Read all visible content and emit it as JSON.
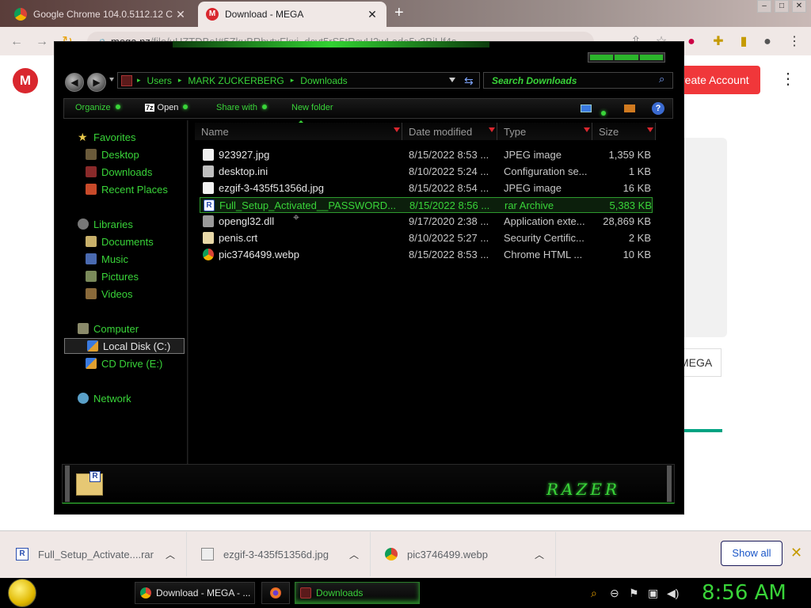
{
  "browser": {
    "tabs": [
      {
        "title": "Google Chrome 104.0.5112.12 C",
        "active": false
      },
      {
        "title": "Download - MEGA",
        "active": true
      }
    ],
    "new_tab_label": "+",
    "omnibox": {
      "domain": "mega.nz",
      "path": "/file/uHZTDBoI#5ZkuBRbvtxFkxi_dcvt5rS5tRcvH2wLado5y3BiLlf4s"
    }
  },
  "mega": {
    "logo_letter": "M",
    "create_account": "reate Account",
    "button_partial": "MEGA"
  },
  "explorer": {
    "breadcrumbs": [
      "Users",
      "MARK ZUCKERBERG",
      "Downloads"
    ],
    "search_placeholder": "Search Downloads",
    "commands": {
      "organize": "Organize",
      "open": "Open",
      "share_with": "Share with",
      "new_folder": "New folder",
      "open_badge": "7z"
    },
    "nav": {
      "favorites": "Favorites",
      "desktop": "Desktop",
      "downloads": "Downloads",
      "recent": "Recent Places",
      "libraries": "Libraries",
      "documents": "Documents",
      "music": "Music",
      "pictures": "Pictures",
      "videos": "Videos",
      "computer": "Computer",
      "local_disk": "Local Disk (C:)",
      "cd_drive": "CD Drive (E:)",
      "network": "Network"
    },
    "columns": [
      "Name",
      "Date modified",
      "Type",
      "Size"
    ],
    "files": [
      {
        "name": "923927.jpg",
        "date": "8/15/2022 8:53 ...",
        "type": "JPEG image",
        "size": "1,359 KB",
        "icon": "image-file-icon",
        "color": "#f2f2f2"
      },
      {
        "name": "desktop.ini",
        "date": "8/10/2022 5:24 ...",
        "type": "Configuration se...",
        "size": "1 KB",
        "icon": "config-file-icon",
        "color": "#bfbfbf"
      },
      {
        "name": "ezgif-3-435f51356d.jpg",
        "date": "8/15/2022 8:54 ...",
        "type": "JPEG image",
        "size": "16 KB",
        "icon": "image-file-icon",
        "color": "#f2f2f2"
      },
      {
        "name": "Full_Setup_Activated__PASSWORD...",
        "date": "8/15/2022 8:56 ...",
        "type": "rar Archive",
        "size": "5,383 KB",
        "icon": "rar-archive-icon",
        "color": "#2a4fb0"
      },
      {
        "name": "opengl32.dll",
        "date": "9/17/2020 2:38 ...",
        "type": "Application exte...",
        "size": "28,869 KB",
        "icon": "dll-file-icon",
        "color": "#9a9a9a"
      },
      {
        "name": "penis.crt",
        "date": "8/10/2022 5:27 ...",
        "type": "Security Certific...",
        "size": "2 KB",
        "icon": "certificate-icon",
        "color": "#e8d8a8"
      },
      {
        "name": "pic3746499.webp",
        "date": "8/15/2022 8:53 ...",
        "type": "Chrome HTML ...",
        "size": "10 KB",
        "icon": "chrome-icon",
        "color": "#db4437"
      }
    ],
    "selected_index": 3,
    "details_badge": "R",
    "brand": "RAZER"
  },
  "downloads_shelf": {
    "items": [
      {
        "name": "Full_Setup_Activate....rar"
      },
      {
        "name": "ezgif-3-435f51356d.jpg"
      },
      {
        "name": "pic3746499.webp"
      }
    ],
    "show_all": "Show all",
    "close": "✕"
  },
  "taskbar": {
    "buttons": [
      {
        "label": "Download - MEGA - ..."
      },
      {
        "label": ""
      },
      {
        "label": "Downloads"
      }
    ],
    "clock": "8:56 AM"
  },
  "colors": {
    "accent_green": "#39d439",
    "mega_red": "#d9272e",
    "create_red": "#f0373a"
  }
}
